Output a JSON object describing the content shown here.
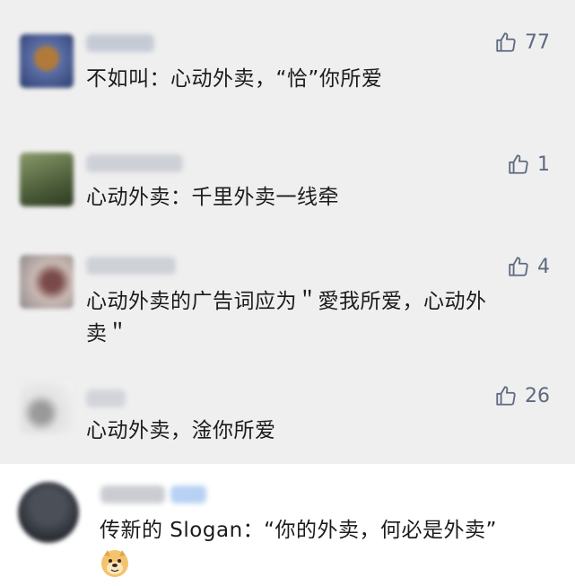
{
  "comments": [
    {
      "username": "Eeeaaay",
      "likes": "77",
      "text": "不如叫：心动外卖，“恰”你所爱"
    },
    {
      "username": "lingwen · 思",
      "likes": "1",
      "text": "心动外卖：千里外卖一线牵"
    },
    {
      "username": "生若朗晴",
      "likes": "4",
      "text_line1": "心动外卖的广告词应为＂愛我所爱，心动外",
      "text_line2": "卖＂"
    },
    {
      "username": "ooh",
      "likes": "26",
      "text": "心动外卖，淦你所爱"
    },
    {
      "username": "喵喵 ··",
      "text": "传新的 Slogan：“你的外卖，何必是外卖”",
      "emoji": "doge-emoji"
    }
  ],
  "colors": {
    "background": "#efefef",
    "like": "#5f6a80",
    "text": "#1b1b1b",
    "highlight_row": "#ffffff"
  }
}
